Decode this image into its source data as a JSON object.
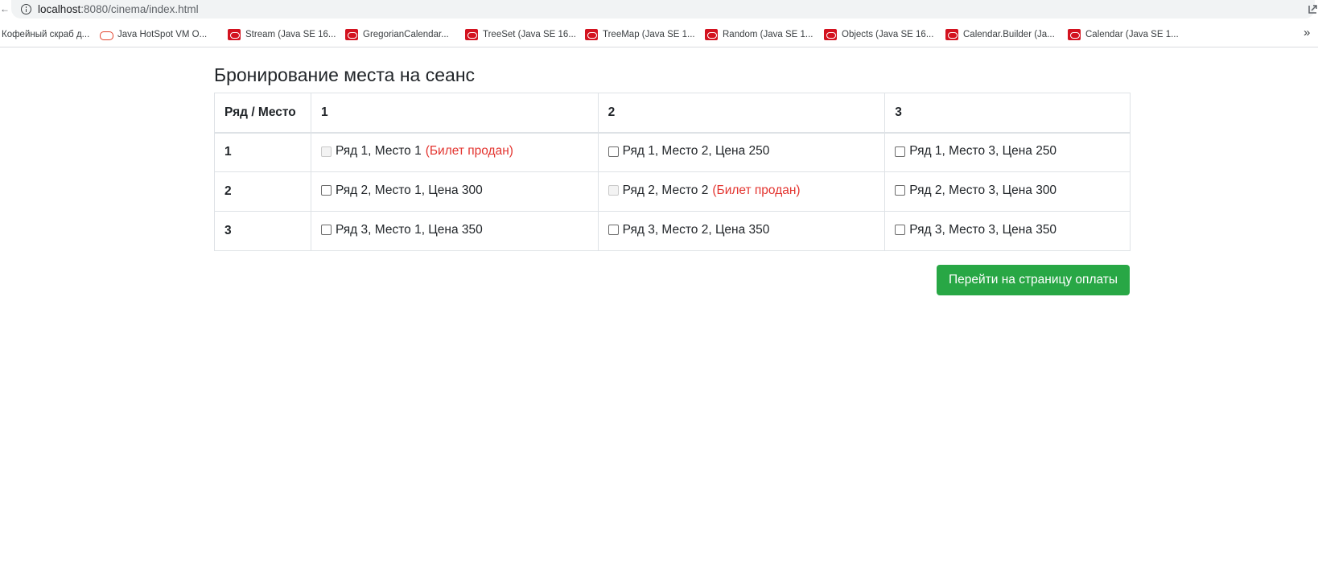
{
  "browser": {
    "leading_char": "←",
    "url_host": "localhost",
    "url_path": ":8080/cinema/index.html",
    "bookmarks": [
      {
        "label": "Кофейный скраб д...",
        "icon": "none"
      },
      {
        "label": "Java HotSpot VM O...",
        "icon": "oracle-ring-icon"
      },
      {
        "label": "Stream (Java SE 16...",
        "icon": "oracle-icon"
      },
      {
        "label": "GregorianCalendar...",
        "icon": "oracle-icon"
      },
      {
        "label": "TreeSet (Java SE 16...",
        "icon": "oracle-icon"
      },
      {
        "label": "TreeMap (Java SE 1...",
        "icon": "oracle-icon"
      },
      {
        "label": "Random (Java SE 1...",
        "icon": "oracle-icon"
      },
      {
        "label": "Objects (Java SE 16...",
        "icon": "oracle-icon"
      },
      {
        "label": "Calendar.Builder (Ja...",
        "icon": "oracle-icon"
      },
      {
        "label": "Calendar (Java SE 1...",
        "icon": "oracle-icon"
      }
    ],
    "more_label": "»"
  },
  "page": {
    "title": "Бронирование места на сеанс",
    "table": {
      "corner_header": "Ряд / Место",
      "columns": [
        "1",
        "2",
        "3"
      ],
      "rows": [
        {
          "label": "1",
          "cells": [
            {
              "text": "Ряд 1, Место 1",
              "sold": true,
              "sold_note": "(Билет продан)"
            },
            {
              "text": "Ряд 1, Место 2, Цена 250",
              "sold": false,
              "sold_note": ""
            },
            {
              "text": "Ряд 1, Место 3, Цена 250",
              "sold": false,
              "sold_note": ""
            }
          ]
        },
        {
          "label": "2",
          "cells": [
            {
              "text": "Ряд 2, Место 1, Цена 300",
              "sold": false,
              "sold_note": ""
            },
            {
              "text": "Ряд 2, Место 2",
              "sold": true,
              "sold_note": "(Билет продан)"
            },
            {
              "text": "Ряд 2, Место 3, Цена 300",
              "sold": false,
              "sold_note": ""
            }
          ]
        },
        {
          "label": "3",
          "cells": [
            {
              "text": "Ряд 3, Место 1, Цена 350",
              "sold": false,
              "sold_note": ""
            },
            {
              "text": "Ряд 3, Место 2, Цена 350",
              "sold": false,
              "sold_note": ""
            },
            {
              "text": "Ряд 3, Место 3, Цена 350",
              "sold": false,
              "sold_note": ""
            }
          ]
        }
      ]
    },
    "pay_button_label": "Перейти на страницу оплаты"
  },
  "colors": {
    "sold_text": "#e3342f",
    "button_bg": "#28a745",
    "oracle_red": "#d3121f"
  }
}
